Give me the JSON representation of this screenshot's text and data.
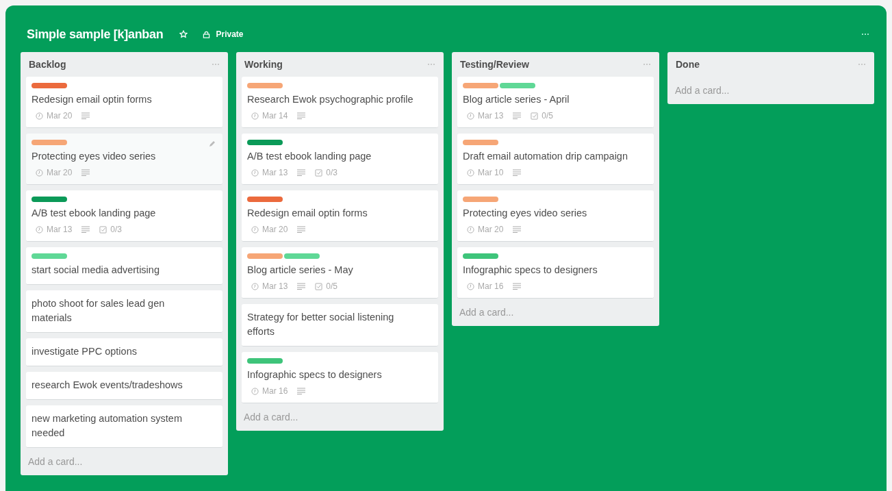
{
  "board": {
    "title": "Simple sample [k]anban",
    "visibility": "Private"
  },
  "lists": [
    {
      "name": "Backlog",
      "add_card": "Add a card...",
      "cards": [
        {
          "labels": [
            {
              "color": "#eb6a3d"
            }
          ],
          "title": "Redesign email optin forms",
          "hovered": false,
          "badges": [
            {
              "kind": "due",
              "text": "Mar 20"
            },
            {
              "kind": "description"
            }
          ]
        },
        {
          "labels": [
            {
              "color": "#f6a676"
            }
          ],
          "title": "Protecting eyes video series",
          "hovered": true,
          "badges": [
            {
              "kind": "due",
              "text": "Mar 20"
            },
            {
              "kind": "description"
            }
          ]
        },
        {
          "labels": [
            {
              "color": "#0b9a58"
            }
          ],
          "title": "A/B test ebook landing page",
          "hovered": false,
          "badges": [
            {
              "kind": "due",
              "text": "Mar 13"
            },
            {
              "kind": "description"
            },
            {
              "kind": "checklist",
              "text": "0/3"
            }
          ]
        },
        {
          "labels": [
            {
              "color": "#5fd896"
            }
          ],
          "title": "start social media advertising",
          "hovered": false
        },
        {
          "title": "photo shoot for sales lead gen materials",
          "hovered": false
        },
        {
          "title": "investigate PPC options",
          "hovered": false
        },
        {
          "title": "research Ewok events/tradeshows",
          "hovered": false
        },
        {
          "title": "new marketing automation system needed",
          "hovered": false
        }
      ]
    },
    {
      "name": "Working",
      "add_card": "Add a card...",
      "cards": [
        {
          "labels": [
            {
              "color": "#f6a676"
            }
          ],
          "title": "Research Ewok psychographic profile",
          "hovered": false,
          "badges": [
            {
              "kind": "due",
              "text": "Mar 14"
            },
            {
              "kind": "description"
            }
          ]
        },
        {
          "labels": [
            {
              "color": "#0b9a58"
            }
          ],
          "title": "A/B test ebook landing page",
          "hovered": false,
          "badges": [
            {
              "kind": "due",
              "text": "Mar 13"
            },
            {
              "kind": "description"
            },
            {
              "kind": "checklist",
              "text": "0/3"
            }
          ]
        },
        {
          "labels": [
            {
              "color": "#eb6a3d"
            }
          ],
          "title": "Redesign email optin forms",
          "hovered": false,
          "badges": [
            {
              "kind": "due",
              "text": "Mar 20"
            },
            {
              "kind": "description"
            }
          ]
        },
        {
          "labels": [
            {
              "color": "#f6a676"
            },
            {
              "color": "#5fd896"
            }
          ],
          "title": "Blog article series - May",
          "hovered": false,
          "badges": [
            {
              "kind": "due",
              "text": "Mar 13"
            },
            {
              "kind": "description"
            },
            {
              "kind": "checklist",
              "text": "0/5"
            }
          ]
        },
        {
          "title": "Strategy for better social listening efforts",
          "hovered": false
        },
        {
          "labels": [
            {
              "color": "#3ec47a"
            }
          ],
          "title": "Infographic specs to designers",
          "hovered": false,
          "badges": [
            {
              "kind": "due",
              "text": "Mar 16"
            },
            {
              "kind": "description"
            }
          ]
        }
      ]
    },
    {
      "name": "Testing/Review",
      "add_card": "Add a card...",
      "cards": [
        {
          "labels": [
            {
              "color": "#f6a676"
            },
            {
              "color": "#5fd896"
            }
          ],
          "title": "Blog article series - April",
          "hovered": false,
          "badges": [
            {
              "kind": "due",
              "text": "Mar 13"
            },
            {
              "kind": "description"
            },
            {
              "kind": "checklist",
              "text": "0/5"
            }
          ]
        },
        {
          "labels": [
            {
              "color": "#f6a676"
            }
          ],
          "title": "Draft email automation drip campaign",
          "hovered": false,
          "badges": [
            {
              "kind": "due",
              "text": "Mar 10"
            },
            {
              "kind": "description"
            }
          ]
        },
        {
          "labels": [
            {
              "color": "#f6a676"
            }
          ],
          "title": "Protecting eyes video series",
          "hovered": false,
          "badges": [
            {
              "kind": "due",
              "text": "Mar 20"
            },
            {
              "kind": "description"
            }
          ]
        },
        {
          "labels": [
            {
              "color": "#3ec47a"
            }
          ],
          "title": "Infographic specs to designers",
          "hovered": false,
          "badges": [
            {
              "kind": "due",
              "text": "Mar 16"
            },
            {
              "kind": "description"
            }
          ]
        }
      ]
    },
    {
      "name": "Done",
      "add_card": "Add a card..."
    }
  ]
}
